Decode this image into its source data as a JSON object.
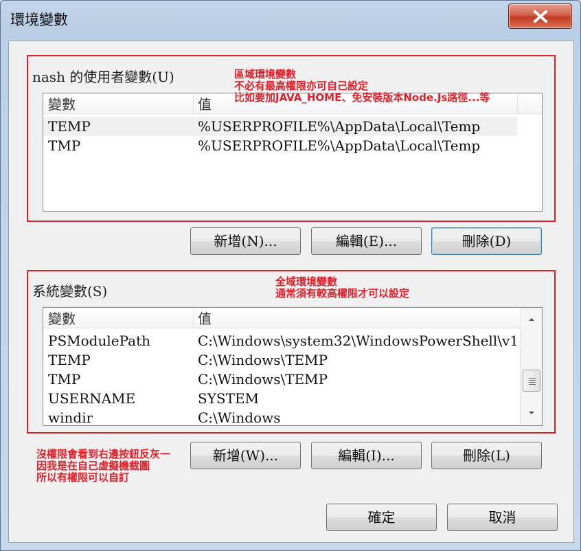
{
  "window": {
    "title": "環境變數"
  },
  "user_group": {
    "title": "nash 的使用者變數(U)",
    "columns": [
      "變數",
      "值"
    ],
    "rows": [
      {
        "name": "TEMP",
        "value": "%USERPROFILE%\\AppData\\Local\\Temp"
      },
      {
        "name": "TMP",
        "value": "%USERPROFILE%\\AppData\\Local\\Temp"
      }
    ],
    "buttons": {
      "new": "新增(N)...",
      "edit": "編輯(E)...",
      "delete": "刪除(D)"
    }
  },
  "system_group": {
    "title": "系統變數(S)",
    "columns": [
      "變數",
      "值"
    ],
    "rows": [
      {
        "name": "PSModulePath",
        "value": "C:\\Windows\\system32\\WindowsPowerShell\\v1.0..."
      },
      {
        "name": "TEMP",
        "value": "C:\\Windows\\TEMP"
      },
      {
        "name": "TMP",
        "value": "C:\\Windows\\TEMP"
      },
      {
        "name": "USERNAME",
        "value": "SYSTEM"
      },
      {
        "name": "windir",
        "value": "C:\\Windows"
      }
    ],
    "buttons": {
      "new": "新增(W)...",
      "edit": "編輯(I)...",
      "delete": "刪除(L)"
    }
  },
  "dialog_buttons": {
    "ok": "確定",
    "cancel": "取消"
  },
  "annotations": {
    "user": "區域環境變數\n不必有最高權限亦可自己設定\n比如要加JAVA_HOME、免安裝版本Node.Js路徑...等",
    "system": "全域環境變數\n通常須有較高權限才可以設定",
    "note": "沒權限會看到右邊按鈕反灰一\n因我是在自己虛擬機截圖\n所以有權限可以自訂"
  },
  "colors": {
    "annotation": "#e0202a",
    "client_bg": "#f0f0f0",
    "close_button": "#c0391f"
  }
}
